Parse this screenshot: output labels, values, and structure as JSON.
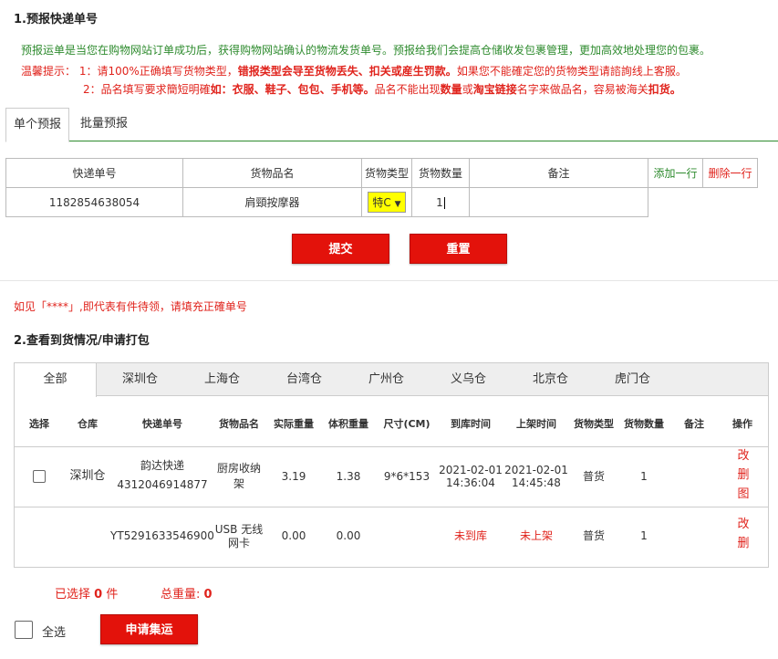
{
  "section1": {
    "title": "1.预报快递单号",
    "intro": "预报运单是当您在购物网站订单成功后，获得购物网站确认的物流发货单号。预报给我们会提高仓储收发包裹管理，更加高效地处理您的包裹。",
    "tip_label": "温馨提示：",
    "tip1_prefix": "1：请100%正确填写货物类型，",
    "tip1_bold": "错报类型会导至货物丢失、扣关或産生罚款。",
    "tip1_suffix": "如果您不能確定您的货物类型请諮詢线上客服。",
    "tip2_prefix": "2：品名填写要求簡短明確",
    "tip2_bold": "如：衣服、鞋子、包包、手机等。",
    "tip2_mid": "品名不能出现",
    "tip2_bold2": "数量",
    "tip2_mid2": "或",
    "tip2_bold3": "淘宝链接",
    "tip2_mid3": "名字来做品名，容易被海关",
    "tip2_bold4": "扣货。"
  },
  "tabs1": {
    "single": "单个预报",
    "batch": "批量预报"
  },
  "prereport_table": {
    "headers": [
      "快递单号",
      "货物品名",
      "货物类型",
      "货物数量",
      "备注"
    ],
    "add_row": "添加一行",
    "delete_row": "删除一行",
    "row": {
      "tracking": "1182854638054",
      "name": "肩頸按摩器",
      "type": "特C",
      "qty": "1",
      "remark": ""
    }
  },
  "buttons": {
    "submit": "提交",
    "reset": "重置",
    "apply_pack": "申请集运"
  },
  "notice": "如见「****」,即代表有件待领，请填充正確单号",
  "section2": {
    "title": "2.查看到货情况/申请打包"
  },
  "tabs2": [
    "全部",
    "深圳仓",
    "上海仓",
    "台湾仓",
    "广州仓",
    "义乌仓",
    "北京仓",
    "虎门仓"
  ],
  "list_headers": [
    "选择",
    "仓库",
    "快递单号",
    "货物品名",
    "实际重量",
    "体积重量",
    "尺寸(CM)",
    "到库时间",
    "上架时间",
    "货物类型",
    "货物数量",
    "备注",
    "操作"
  ],
  "rows": [
    {
      "warehouse": "深圳仓",
      "carrier": "韵达快递",
      "tracking": "4312046914877",
      "name": "厨房收纳架",
      "name_l1": "厨房收纳",
      "name_l2": "架",
      "actual_weight": "3.19",
      "volume_weight": "1.38",
      "size": "9*6*153",
      "arrive_date": "2021-02-01",
      "arrive_time": "14:36:04",
      "shelf_date": "2021-02-01",
      "shelf_time": "14:45:48",
      "type": "普货",
      "qty": "1",
      "ops": [
        "改",
        "删",
        "图"
      ]
    },
    {
      "warehouse": "",
      "tracking": "YT5291633546900",
      "name_l1": "USB 无线",
      "name_l2": "网卡",
      "actual_weight": "0.00",
      "volume_weight": "0.00",
      "size": "",
      "arrive": "未到库",
      "shelf": "未上架",
      "type": "普货",
      "qty": "1",
      "ops": [
        "改",
        "删"
      ]
    }
  ],
  "summary": {
    "selected_label": "已选择",
    "selected_count": "0",
    "selected_unit": "件",
    "total_weight_label": "总重量:",
    "total_weight": "0"
  },
  "select_all": "全选"
}
